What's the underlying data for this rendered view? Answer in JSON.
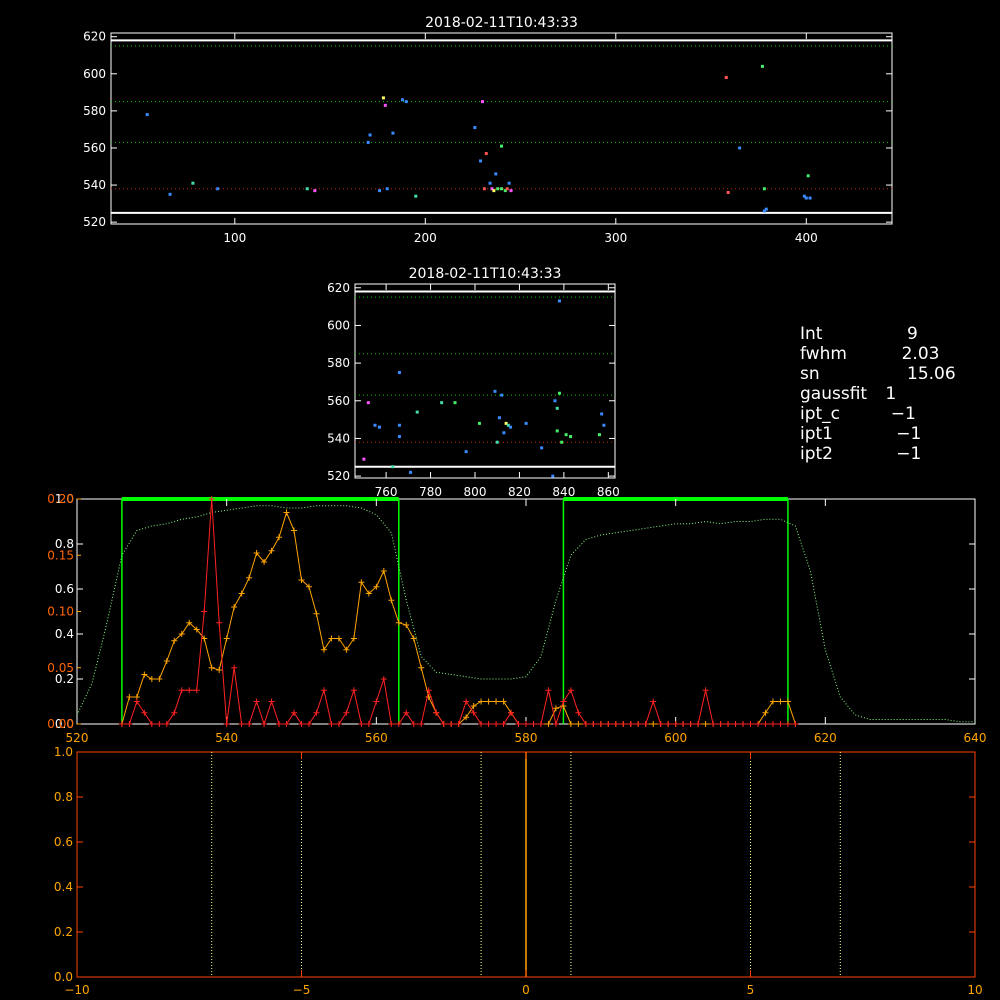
{
  "chart_data": [
    {
      "type": "scatter",
      "title": "2018-02-11T10:43:33",
      "xlim": [
        35,
        445
      ],
      "ylim": [
        519,
        622
      ],
      "x_ticks": [
        100,
        200,
        300,
        400
      ],
      "y_ticks": [
        520,
        540,
        560,
        580,
        600,
        620
      ],
      "hlines_solid": [
        525,
        618
      ],
      "hlines_dotted": [
        {
          "y": 615,
          "color": "#00cc00"
        },
        {
          "y": 585,
          "color": "#00cc00"
        },
        {
          "y": 563,
          "color": "#00cc00"
        },
        {
          "y": 538,
          "color": "#cc2200"
        }
      ],
      "points": [
        {
          "x": 54,
          "y": 578,
          "c": "#3a8bff"
        },
        {
          "x": 66,
          "y": 535,
          "c": "#3a8bff"
        },
        {
          "x": 78,
          "y": 541,
          "c": "#44ddaa"
        },
        {
          "x": 91,
          "y": 538,
          "c": "#3a8bff"
        },
        {
          "x": 138,
          "y": 538,
          "c": "#44ddaa"
        },
        {
          "x": 142,
          "y": 537,
          "c": "#ff55ff"
        },
        {
          "x": 170,
          "y": 563,
          "c": "#3a8bff"
        },
        {
          "x": 171,
          "y": 567,
          "c": "#3a8bff"
        },
        {
          "x": 176,
          "y": 537,
          "c": "#3a8bff"
        },
        {
          "x": 178,
          "y": 587,
          "c": "#ffff66"
        },
        {
          "x": 179,
          "y": 583,
          "c": "#ff55ff"
        },
        {
          "x": 180,
          "y": 538,
          "c": "#3a8bff"
        },
        {
          "x": 183,
          "y": 568,
          "c": "#3a8bff"
        },
        {
          "x": 188,
          "y": 586,
          "c": "#3a8bff"
        },
        {
          "x": 190,
          "y": 585,
          "c": "#3a8bff"
        },
        {
          "x": 195,
          "y": 534,
          "c": "#44ddaa"
        },
        {
          "x": 226,
          "y": 571,
          "c": "#3a8bff"
        },
        {
          "x": 229,
          "y": 553,
          "c": "#3a8bff"
        },
        {
          "x": 230,
          "y": 585,
          "c": "#ff55ff"
        },
        {
          "x": 231,
          "y": 538,
          "c": "#ff5555"
        },
        {
          "x": 232,
          "y": 557,
          "c": "#ff5555"
        },
        {
          "x": 234,
          "y": 541,
          "c": "#3a8bff"
        },
        {
          "x": 235,
          "y": 538,
          "c": "#ff55ff"
        },
        {
          "x": 236,
          "y": 537,
          "c": "#ffff66"
        },
        {
          "x": 237,
          "y": 546,
          "c": "#3a8bff"
        },
        {
          "x": 238,
          "y": 538,
          "c": "#44ee66"
        },
        {
          "x": 240,
          "y": 538,
          "c": "#44ee66"
        },
        {
          "x": 240,
          "y": 561,
          "c": "#44ee66"
        },
        {
          "x": 242,
          "y": 537,
          "c": "#44ee66"
        },
        {
          "x": 243,
          "y": 538,
          "c": "#ff5555"
        },
        {
          "x": 244,
          "y": 541,
          "c": "#3a8bff"
        },
        {
          "x": 245,
          "y": 537,
          "c": "#ff55ff"
        },
        {
          "x": 358,
          "y": 598,
          "c": "#ff5555"
        },
        {
          "x": 359,
          "y": 536,
          "c": "#ff5555"
        },
        {
          "x": 365,
          "y": 560,
          "c": "#3a8bff"
        },
        {
          "x": 377,
          "y": 604,
          "c": "#44ee66"
        },
        {
          "x": 378,
          "y": 538,
          "c": "#44ee66"
        },
        {
          "x": 378,
          "y": 526,
          "c": "#3a8bff"
        },
        {
          "x": 379,
          "y": 527,
          "c": "#3a8bff"
        },
        {
          "x": 399,
          "y": 534,
          "c": "#3a8bff"
        },
        {
          "x": 400,
          "y": 533,
          "c": "#3a8bff"
        },
        {
          "x": 401,
          "y": 545,
          "c": "#44ee66"
        },
        {
          "x": 402,
          "y": 533,
          "c": "#3a8bff"
        }
      ]
    },
    {
      "type": "scatter",
      "title": "2018-02-11T10:43:33",
      "xlim": [
        746,
        863
      ],
      "ylim": [
        519,
        622
      ],
      "x_ticks": [
        760,
        780,
        800,
        820,
        840,
        860
      ],
      "y_ticks": [
        520,
        540,
        560,
        580,
        600,
        620
      ],
      "hlines_solid": [
        525,
        618
      ],
      "hlines_dotted": [
        {
          "y": 615,
          "color": "#00cc00"
        },
        {
          "y": 585,
          "color": "#00cc00"
        },
        {
          "y": 563,
          "color": "#00cc00"
        },
        {
          "y": 538,
          "color": "#cc2200"
        }
      ],
      "points": [
        {
          "x": 750,
          "y": 529,
          "c": "#ff55ff"
        },
        {
          "x": 752,
          "y": 559,
          "c": "#ff55ff"
        },
        {
          "x": 755,
          "y": 547,
          "c": "#3a8bff"
        },
        {
          "x": 757,
          "y": 546,
          "c": "#3a8bff"
        },
        {
          "x": 763,
          "y": 525,
          "c": "#44ddaa"
        },
        {
          "x": 766,
          "y": 575,
          "c": "#3a8bff"
        },
        {
          "x": 766,
          "y": 547,
          "c": "#3a8bff"
        },
        {
          "x": 766,
          "y": 541,
          "c": "#3a8bff"
        },
        {
          "x": 771,
          "y": 522,
          "c": "#3a8bff"
        },
        {
          "x": 774,
          "y": 554,
          "c": "#44ddaa"
        },
        {
          "x": 785,
          "y": 559,
          "c": "#44ddaa"
        },
        {
          "x": 791,
          "y": 559,
          "c": "#44ee66"
        },
        {
          "x": 796,
          "y": 533,
          "c": "#3a8bff"
        },
        {
          "x": 802,
          "y": 548,
          "c": "#44ee66"
        },
        {
          "x": 809,
          "y": 565,
          "c": "#3a8bff"
        },
        {
          "x": 810,
          "y": 538,
          "c": "#44ddaa"
        },
        {
          "x": 811,
          "y": 551,
          "c": "#3a8bff"
        },
        {
          "x": 812,
          "y": 563,
          "c": "#3a8bff"
        },
        {
          "x": 813,
          "y": 543,
          "c": "#3a8bff"
        },
        {
          "x": 814,
          "y": 548,
          "c": "#ffff66"
        },
        {
          "x": 815,
          "y": 547,
          "c": "#44ddaa"
        },
        {
          "x": 816,
          "y": 546,
          "c": "#3a8bff"
        },
        {
          "x": 823,
          "y": 548,
          "c": "#3a8bff"
        },
        {
          "x": 830,
          "y": 535,
          "c": "#3a8bff"
        },
        {
          "x": 835,
          "y": 520,
          "c": "#3a8bff"
        },
        {
          "x": 836,
          "y": 560,
          "c": "#3a8bff"
        },
        {
          "x": 837,
          "y": 556,
          "c": "#44ddaa"
        },
        {
          "x": 837,
          "y": 544,
          "c": "#44ee66"
        },
        {
          "x": 838,
          "y": 564,
          "c": "#44ee66"
        },
        {
          "x": 838,
          "y": 613,
          "c": "#3a8bff"
        },
        {
          "x": 839,
          "y": 538,
          "c": "#44ee66"
        },
        {
          "x": 841,
          "y": 542,
          "c": "#44ee66"
        },
        {
          "x": 843,
          "y": 541,
          "c": "#44ee66"
        },
        {
          "x": 856,
          "y": 542,
          "c": "#44ee66"
        },
        {
          "x": 857,
          "y": 553,
          "c": "#3a8bff"
        },
        {
          "x": 858,
          "y": 547,
          "c": "#3a8bff"
        }
      ]
    },
    {
      "type": "line",
      "xlim": [
        520,
        640
      ],
      "x_ticks": [
        520,
        540,
        560,
        580,
        600,
        620,
        640
      ],
      "ylim_left": [
        0,
        1.0
      ],
      "y_ticks_left": [
        "0.0",
        "0.2",
        "0.4",
        "0.6",
        "0.8",
        "1.0"
      ],
      "ylim_inner": [
        0,
        0.2
      ],
      "y_ticks_inner": [
        "0.00",
        "0.05",
        "0.10",
        "0.15",
        "0.20"
      ],
      "windows": [
        [
          526,
          563
        ],
        [
          585,
          615
        ]
      ],
      "window_color": "#00ff00",
      "series": [
        {
          "color": "#88ff88",
          "style": "dotted",
          "axis": "left",
          "x": [
            520,
            522,
            524,
            526,
            528,
            530,
            532,
            534,
            536,
            538,
            540,
            542,
            544,
            546,
            548,
            550,
            552,
            554,
            556,
            558,
            560,
            562,
            564,
            566,
            568,
            570,
            572,
            574,
            576,
            578,
            580,
            582,
            584,
            586,
            588,
            590,
            592,
            594,
            596,
            598,
            600,
            602,
            604,
            606,
            608,
            610,
            612,
            614,
            616,
            618,
            620,
            622,
            624,
            626,
            628,
            630,
            632,
            634,
            636,
            638,
            640
          ],
          "y": [
            0.04,
            0.18,
            0.45,
            0.75,
            0.86,
            0.88,
            0.89,
            0.91,
            0.92,
            0.94,
            0.95,
            0.96,
            0.97,
            0.97,
            0.96,
            0.96,
            0.97,
            0.97,
            0.97,
            0.96,
            0.93,
            0.85,
            0.55,
            0.3,
            0.23,
            0.22,
            0.21,
            0.2,
            0.2,
            0.2,
            0.21,
            0.3,
            0.55,
            0.75,
            0.82,
            0.84,
            0.85,
            0.86,
            0.87,
            0.88,
            0.89,
            0.89,
            0.9,
            0.89,
            0.9,
            0.9,
            0.91,
            0.91,
            0.88,
            0.68,
            0.33,
            0.12,
            0.04,
            0.02,
            0.02,
            0.02,
            0.02,
            0.02,
            0.02,
            0.01,
            0.01
          ]
        },
        {
          "color": "#ffa500",
          "style": "solid+",
          "axis": "left",
          "x": [
            526,
            527,
            528,
            529,
            530,
            531,
            532,
            533,
            534,
            535,
            536,
            537,
            538,
            539,
            540,
            541,
            542,
            543,
            544,
            545,
            546,
            547,
            548,
            549,
            550,
            551,
            552,
            553,
            554,
            555,
            556,
            557,
            558,
            559,
            560,
            561,
            562,
            563,
            564,
            565,
            566,
            567,
            568,
            569,
            570,
            571,
            572,
            573,
            574,
            575,
            576,
            577,
            578,
            579,
            580,
            581,
            582,
            583,
            584,
            585,
            586,
            587,
            588,
            589,
            590,
            591,
            592,
            593,
            594,
            595,
            596,
            597,
            598,
            599,
            600,
            601,
            602,
            603,
            604,
            605,
            606,
            607,
            608,
            609,
            610,
            611,
            612,
            613,
            614,
            615,
            616
          ],
          "y": [
            0.0,
            0.12,
            0.12,
            0.22,
            0.2,
            0.2,
            0.28,
            0.37,
            0.4,
            0.45,
            0.42,
            0.38,
            0.25,
            0.24,
            0.38,
            0.52,
            0.58,
            0.65,
            0.76,
            0.72,
            0.77,
            0.83,
            0.94,
            0.86,
            0.64,
            0.61,
            0.49,
            0.33,
            0.38,
            0.38,
            0.33,
            0.38,
            0.63,
            0.58,
            0.61,
            0.68,
            0.55,
            0.45,
            0.44,
            0.38,
            0.25,
            0.12,
            0.05,
            0.0,
            0.0,
            0.0,
            0.03,
            0.08,
            0.1,
            0.1,
            0.1,
            0.1,
            0.05,
            0.0,
            0.0,
            0.0,
            0.0,
            0.0,
            0.07,
            0.08,
            0.0,
            0.0,
            0.0,
            0.0,
            0.0,
            0.0,
            0.0,
            0.0,
            0.0,
            0.0,
            0.0,
            0.0,
            0.0,
            0.0,
            0.0,
            0.0,
            0.0,
            0.0,
            0.0,
            0.0,
            0.0,
            0.0,
            0.0,
            0.0,
            0.0,
            0.0,
            0.05,
            0.1,
            0.1,
            0.1,
            0.0
          ]
        },
        {
          "color": "#ff2222",
          "style": "solid+",
          "axis": "inner",
          "x": [
            526,
            527,
            528,
            529,
            530,
            531,
            532,
            533,
            534,
            535,
            536,
            537,
            538,
            539,
            540,
            541,
            542,
            543,
            544,
            545,
            546,
            547,
            548,
            549,
            550,
            551,
            552,
            553,
            554,
            555,
            556,
            557,
            558,
            559,
            560,
            561,
            562,
            563,
            564,
            565,
            566,
            567,
            568,
            569,
            570,
            571,
            572,
            573,
            574,
            575,
            576,
            577,
            578,
            579,
            580,
            581,
            582,
            583,
            584,
            585,
            586,
            587,
            588,
            589,
            590,
            591,
            592,
            593,
            594,
            595,
            596,
            597,
            598,
            599,
            600,
            601,
            602,
            603,
            604,
            605,
            606,
            607,
            608,
            609,
            610,
            611,
            612,
            613,
            614,
            615,
            616
          ],
          "y": [
            0.0,
            0.0,
            0.02,
            0.01,
            0.0,
            0.0,
            0.0,
            0.01,
            0.03,
            0.03,
            0.03,
            0.1,
            0.2,
            0.09,
            0.0,
            0.05,
            0.0,
            0.0,
            0.02,
            0.0,
            0.02,
            0.0,
            0.0,
            0.01,
            0.0,
            0.0,
            0.01,
            0.03,
            0.0,
            0.0,
            0.01,
            0.03,
            0.0,
            0.0,
            0.02,
            0.04,
            0.0,
            0.0,
            0.01,
            0.0,
            0.0,
            0.03,
            0.01,
            0.0,
            0.0,
            0.0,
            0.02,
            0.01,
            0.0,
            0.0,
            0.0,
            0.0,
            0.01,
            0.0,
            0.0,
            0.0,
            0.0,
            0.03,
            0.0,
            0.02,
            0.03,
            0.01,
            0.0,
            0.0,
            0.0,
            0.0,
            0.0,
            0.0,
            0.0,
            0.0,
            0.0,
            0.02,
            0.0,
            0.0,
            0.0,
            0.0,
            0.0,
            0.0,
            0.03,
            0.0,
            0.0,
            0.0,
            0.0,
            0.0,
            0.0,
            0.0,
            0.0,
            0.0,
            0.0,
            0.0,
            0.0
          ]
        }
      ]
    },
    {
      "type": "line",
      "xlim": [
        -10,
        10
      ],
      "x_ticks": [
        "-10",
        "-5",
        "0",
        "5",
        "10"
      ],
      "ylim": [
        0,
        1.0
      ],
      "y_ticks": [
        "0.0",
        "0.2",
        "0.4",
        "0.6",
        "0.8",
        "1.0"
      ],
      "vlines_dotted": [
        -7,
        -5,
        -1,
        1,
        5,
        7
      ],
      "vline_solid": 0,
      "vline_solid_color": "#ffa500",
      "axis_color": "#ff4400"
    }
  ],
  "info_panel": [
    {
      "key": "Int",
      "value": "     9"
    },
    {
      "key": "fwhm",
      "value": "    2.03"
    },
    {
      "key": "sn",
      "value": "     15.06"
    },
    {
      "key": "gaussfit",
      "value": " 1"
    },
    {
      "key": "ipt_c",
      "value": "  −1"
    },
    {
      "key": "ipt1",
      "value": "   −1"
    },
    {
      "key": "ipt2",
      "value": "   −1"
    }
  ]
}
